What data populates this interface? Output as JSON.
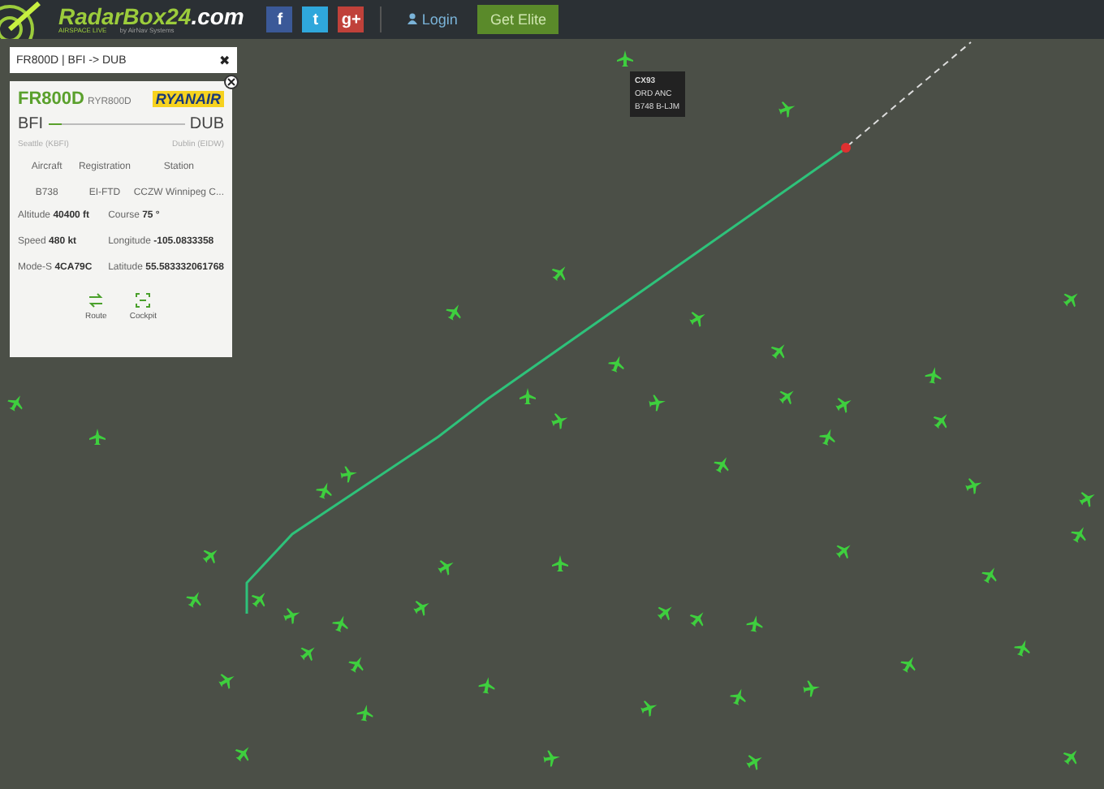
{
  "header": {
    "brand": "RadarBox24",
    "brand_suffix": ".com",
    "tagline": "AIRSPACE LIVE",
    "byline": "by AirNav Systems",
    "social": [
      {
        "kind": "facebook",
        "label": "f"
      },
      {
        "kind": "twitter",
        "label": "t"
      },
      {
        "kind": "google",
        "label": "g+"
      }
    ],
    "login": "Login",
    "elite": "Get Elite"
  },
  "search": {
    "value": "FR800D | BFI -> DUB",
    "clear": "✖"
  },
  "flight": {
    "callsign": "FR800D",
    "code": "RYR800D",
    "airline": "RYANAIR",
    "from": "BFI",
    "to": "DUB",
    "from_name": "Seattle (KBFI)",
    "to_name": "Dublin (EIDW)",
    "level": 0.1,
    "info_headers": [
      "Aircraft",
      "Registration",
      "Station"
    ],
    "info_values": [
      "B738",
      "EI-FTD",
      "CCZW Winnipeg C..."
    ],
    "stats": [
      {
        "label": "Altitude",
        "value": "40400 ft"
      },
      {
        "label": "Course",
        "value": "75 °"
      },
      {
        "label": "Speed",
        "value": "480 kt"
      },
      {
        "label": "Longitude",
        "value": "-105.0833358"
      },
      {
        "label": "Mode-S",
        "value": "4CA79C"
      },
      {
        "label": "Latitude",
        "value": "55.583332061768"
      }
    ],
    "actions": [
      {
        "kind": "route",
        "label": "Route"
      },
      {
        "kind": "cockpit",
        "label": "Cockpit"
      }
    ]
  },
  "tooltip": {
    "lines": [
      "CX93",
      "ORD ANC",
      "B748 B-LJM"
    ]
  }
}
